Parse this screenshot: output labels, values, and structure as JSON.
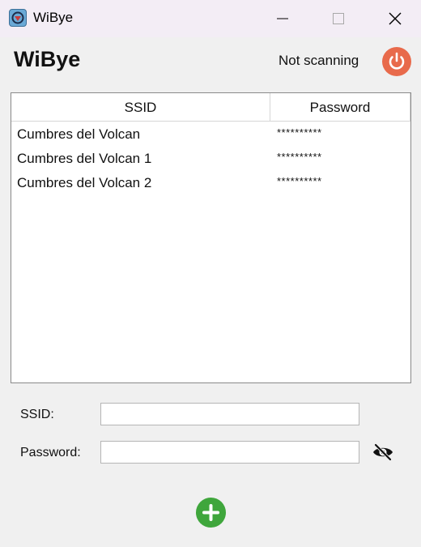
{
  "window": {
    "title": "WiBye",
    "icon": "wibye-app-icon",
    "controls": [
      "minimize-icon",
      "maximize-icon",
      "close-icon"
    ]
  },
  "header": {
    "app_name": "WiBye",
    "scan_status": "Not scanning",
    "power_icon": "power-icon",
    "power_color": "#e86a4b"
  },
  "table": {
    "columns": [
      "SSID",
      "Password"
    ],
    "rows": [
      {
        "ssid": "Cumbres del Volcan",
        "password": "**********"
      },
      {
        "ssid": "Cumbres del Volcan 1",
        "password": "**********"
      },
      {
        "ssid": "Cumbres del Volcan 2",
        "password": "**********"
      }
    ]
  },
  "form": {
    "ssid_label": "SSID:",
    "ssid_value": "",
    "password_label": "Password:",
    "password_value": "",
    "visibility_icon": "eye-off-icon"
  },
  "actions": {
    "add_icon": "plus-icon",
    "add_color": "#3fa63c"
  }
}
